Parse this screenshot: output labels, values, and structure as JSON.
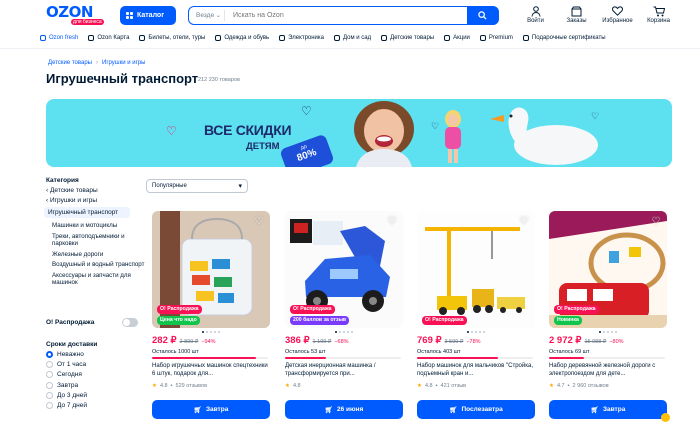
{
  "header": {
    "logo": "OZON",
    "logo_tag": "для бизнеса",
    "catalog_label": "Каталог",
    "search_scope": "Везде",
    "search_placeholder": "Искать на Ozon",
    "actions": [
      {
        "label": "Войти",
        "icon": "user-icon"
      },
      {
        "label": "Заказы",
        "icon": "box-icon"
      },
      {
        "label": "Избранное",
        "icon": "heart-icon"
      },
      {
        "label": "Корзина",
        "icon": "cart-icon"
      }
    ]
  },
  "nav": [
    {
      "label": "Ozon fresh",
      "icon": "leaf-icon"
    },
    {
      "label": "Ozon Карта",
      "icon": "card-icon"
    },
    {
      "label": "Билеты, отели, туры",
      "icon": "plane-icon"
    },
    {
      "label": "Одежда и обувь",
      "icon": "shirt-icon"
    },
    {
      "label": "Электроника",
      "icon": "laptop-icon"
    },
    {
      "label": "Дом и сад",
      "icon": "house-icon"
    },
    {
      "label": "Детские товары",
      "icon": "stroller-icon"
    },
    {
      "label": "Акции",
      "icon": "percent-icon"
    },
    {
      "label": "Premium",
      "icon": "crown-icon"
    },
    {
      "label": "Подарочные сертификаты",
      "icon": "gift-icon"
    }
  ],
  "breadcrumbs": [
    "Детские товары",
    "Игрушки и игры"
  ],
  "page": {
    "title": "Игрушечный транспорт",
    "count": "212 230 товаров"
  },
  "banner": {
    "line1": "ВСЕ СКИДКИ",
    "line2": "ДЕТЯМ",
    "pct_prefix": "до",
    "pct": "80%"
  },
  "sidebar": {
    "category_heading": "Категория",
    "parents": [
      "Детские товары",
      "Игрушки и игры"
    ],
    "active": "Игрушечный транспорт",
    "subs": [
      "Машинки и мотоциклы",
      "Треки, автоподъемники и парковки",
      "Железные дороги",
      "Воздушный и водный транспорт",
      "Аксессуары и запчасти для машинок"
    ],
    "sale_label": "О! Распродажа",
    "delivery_heading": "Сроки доставки",
    "delivery_options": [
      "Неважно",
      "От 1 часа",
      "Сегодня",
      "Завтра",
      "До 3 дней",
      "До 7 дней"
    ],
    "delivery_selected": 0
  },
  "sort": {
    "value": "Популярные"
  },
  "products": [
    {
      "price": "282 ₽",
      "old": "2 899 ₽",
      "disc": "−94%",
      "left": "Осталось 1000 шт",
      "stock": 0.9,
      "name": "Набор игрушечных машинок спецтехники 6 штук, подарок для...",
      "rating": "4.8",
      "reviews": "529 отзывов",
      "buy": "Завтра",
      "tag1": "О! Распродажа",
      "tag2": "Цена что надо",
      "tag2_color": "#10c44c"
    },
    {
      "price": "386 ₽",
      "old": "1 199 ₽",
      "disc": "−68%",
      "left": "Осталось 53 шт",
      "stock": 0.35,
      "name": "Детская инерционная машинка / трансформируется при...",
      "rating": "4.8",
      "reviews": "",
      "buy": "26 июня",
      "tag1": "О! Распродажа",
      "tag2": "200 баллов за отзыв",
      "tag2_color": "#7a3cfa"
    },
    {
      "price": "769 ₽",
      "old": "3 599 ₽",
      "disc": "−78%",
      "left": "Осталось 403 шт",
      "stock": 0.7,
      "name": "Набор машинок для мальчиков \"Стройка, подъемный кран и...",
      "rating": "4.8",
      "reviews": "421 отзыв",
      "buy": "Послезавтра",
      "tag1": "О! Распродажа",
      "tag2": "",
      "tag2_color": ""
    },
    {
      "price": "2 972 ₽",
      "old": "15 088 ₽",
      "disc": "−80%",
      "left": "Осталось 69 шт",
      "stock": 0.3,
      "name": "Набор деревянной железной дороги с электропоездом для дете...",
      "rating": "4.7",
      "reviews": "2 960 отзывов",
      "buy": "Завтра",
      "tag1": "О! Распродажа",
      "tag2": "Новинка",
      "tag2_color": "#10c44c"
    }
  ]
}
